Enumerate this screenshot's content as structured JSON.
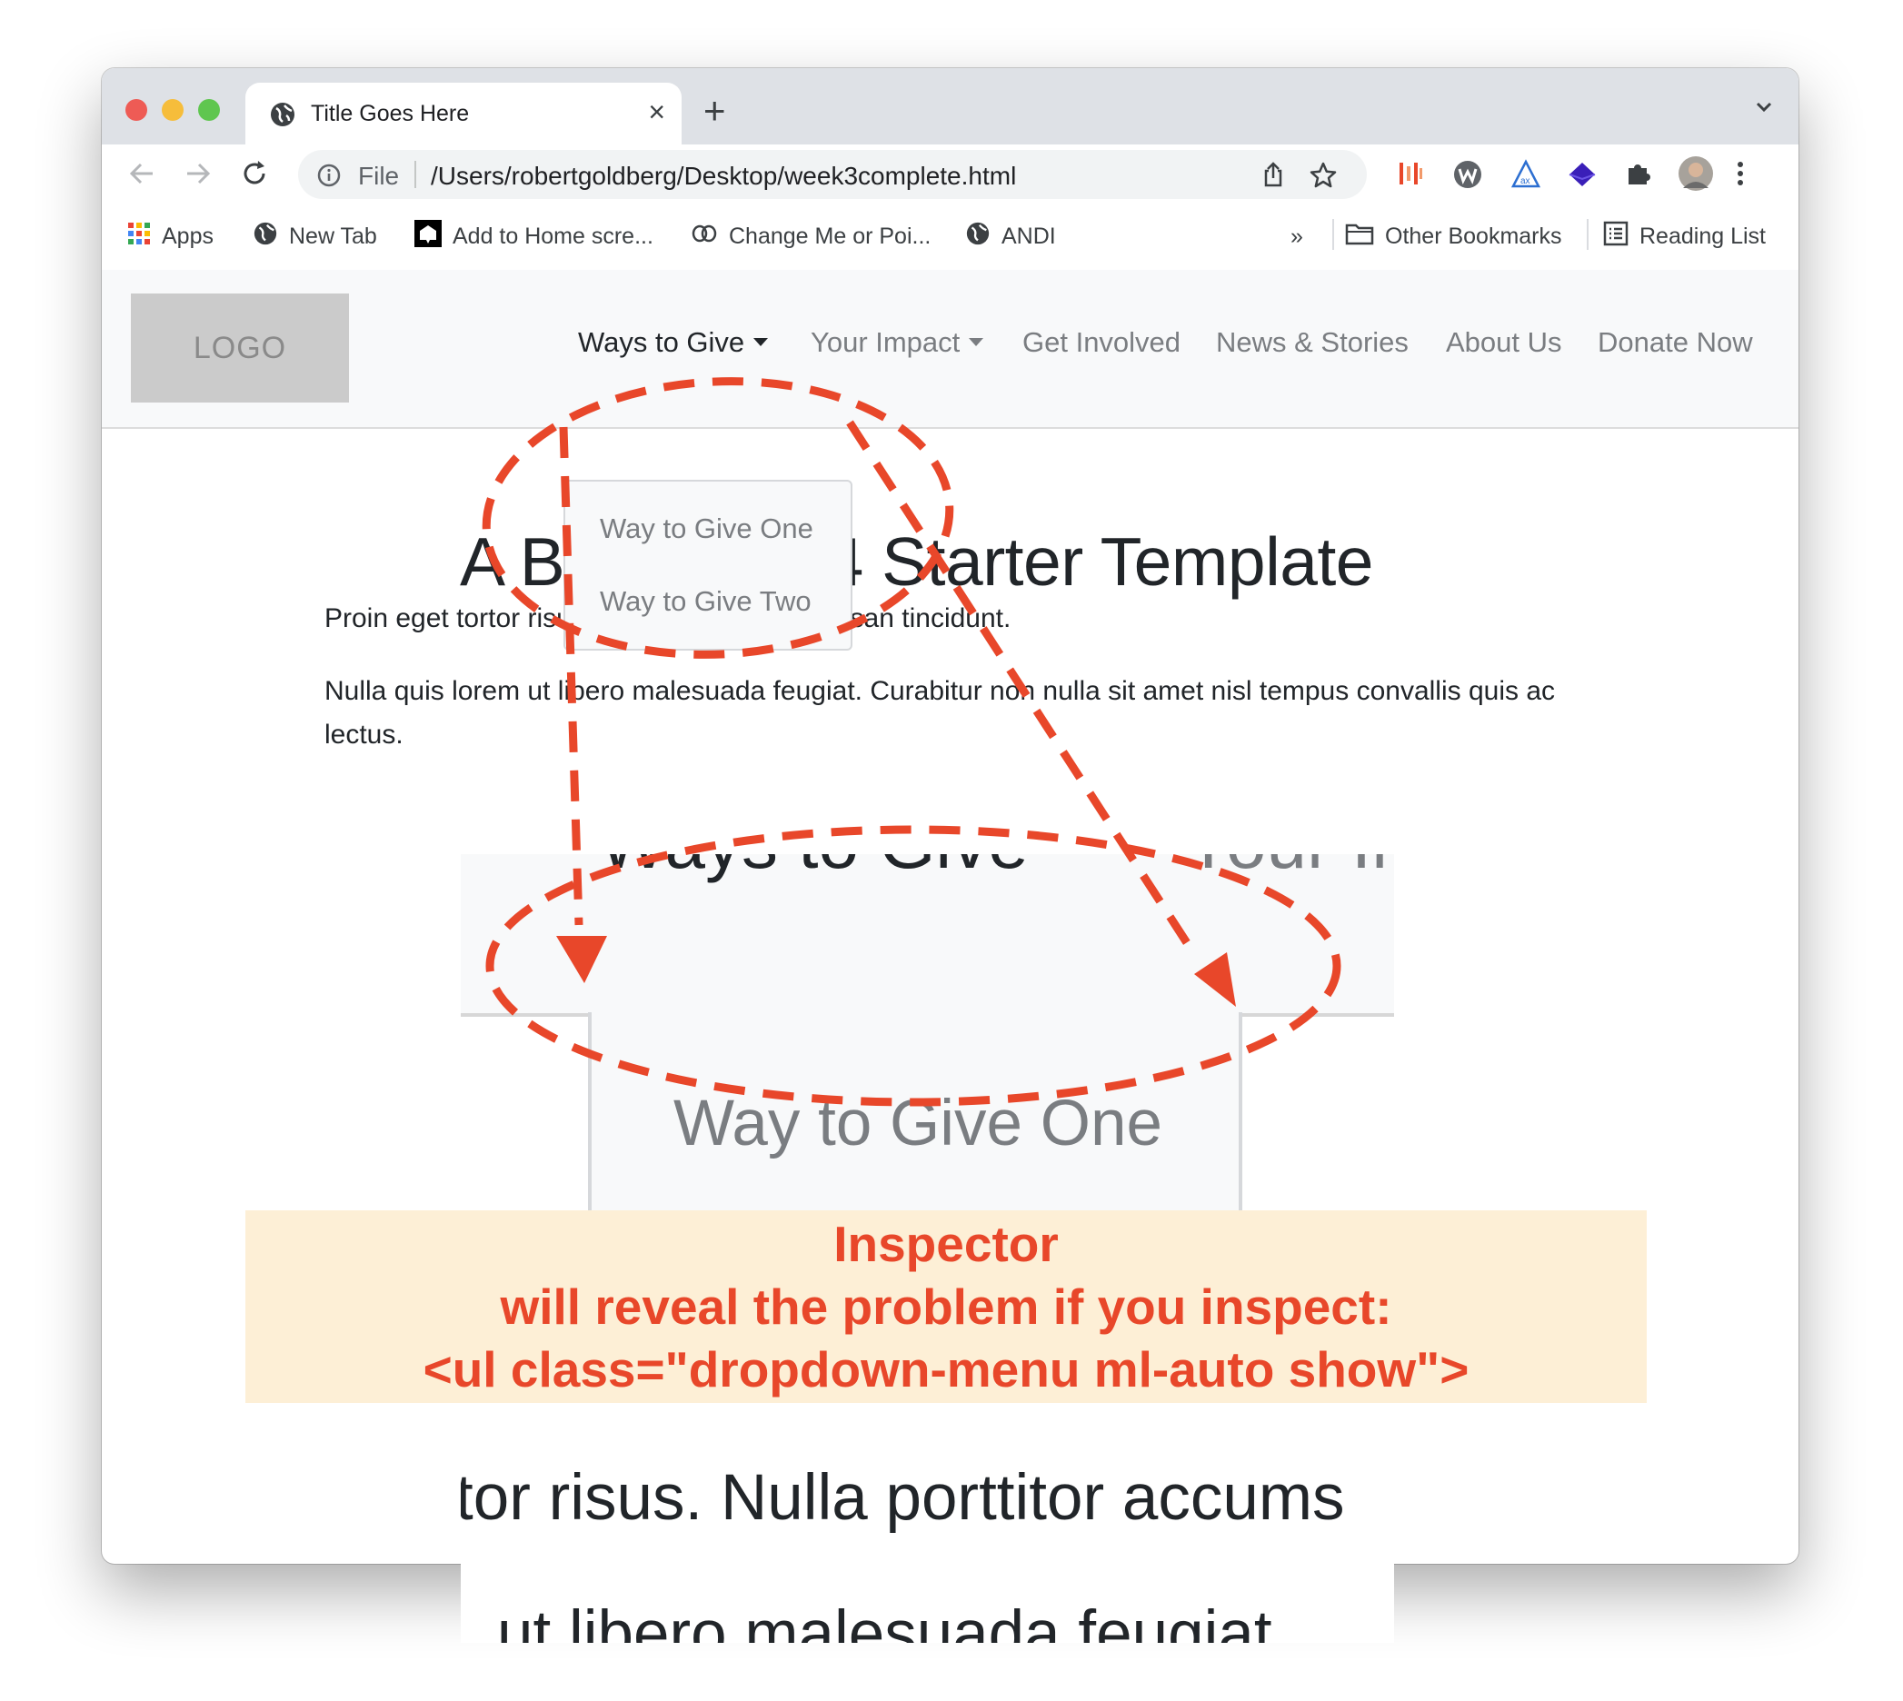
{
  "browser": {
    "tab_title": "Title Goes Here",
    "new_tab_symbol": "+",
    "tab_close_symbol": "×",
    "omnibox": {
      "scheme_label": "File",
      "url": "/Users/robertgoldberg/Desktop/week3complete.html"
    },
    "bookmarks": [
      {
        "label": "Apps",
        "icon": "apps-grid-icon"
      },
      {
        "label": "New Tab",
        "icon": "globe-icon"
      },
      {
        "label": "Add to Home scre...",
        "icon": "home-shortcut-icon"
      },
      {
        "label": "Change Me or Poi...",
        "icon": "link-icon"
      },
      {
        "label": "ANDI",
        "icon": "globe-icon"
      }
    ],
    "bookmarks_overflow": "»",
    "other_bookmarks": "Other Bookmarks",
    "reading_list": "Reading List"
  },
  "site": {
    "logo": "LOGO",
    "nav": [
      {
        "label": "Ways to Give",
        "dropdown": true,
        "active": true
      },
      {
        "label": "Your Impact",
        "dropdown": true,
        "active": false
      },
      {
        "label": "Get Involved",
        "dropdown": false,
        "active": false
      },
      {
        "label": "News & Stories",
        "dropdown": false,
        "active": false
      },
      {
        "label": "About Us",
        "dropdown": false,
        "active": false
      },
      {
        "label": "Donate Now",
        "dropdown": false,
        "active": false
      }
    ],
    "dropdown_items": [
      "Way to Give One",
      "Way to Give Two"
    ],
    "headline": "A Bootstrap 4 Starter Template",
    "paragraphs": [
      "Proin eget tortor risus. Nulla porttitor accumsan tincidunt.",
      "Nulla quis lorem ut libero malesuada feugiat. Curabitur non nulla sit amet nisl tempus convallis quis ac lectus."
    ]
  },
  "zoom_inset": {
    "nav_text_left": "Ways to Give",
    "nav_text_right": "Your Imp",
    "dropdown_item": "Way to Give One",
    "paragraph_fragment": "tor risus. Nulla porttitor accums",
    "paragraph_fragment_2": "ut libero malesuada feugiat"
  },
  "annotation": {
    "lines": [
      "Inspector",
      "will reveal the problem if you inspect:",
      "<ul class=\"dropdown-menu ml-auto show\">"
    ],
    "color": "#e8472a",
    "background": "#fdefd6"
  }
}
